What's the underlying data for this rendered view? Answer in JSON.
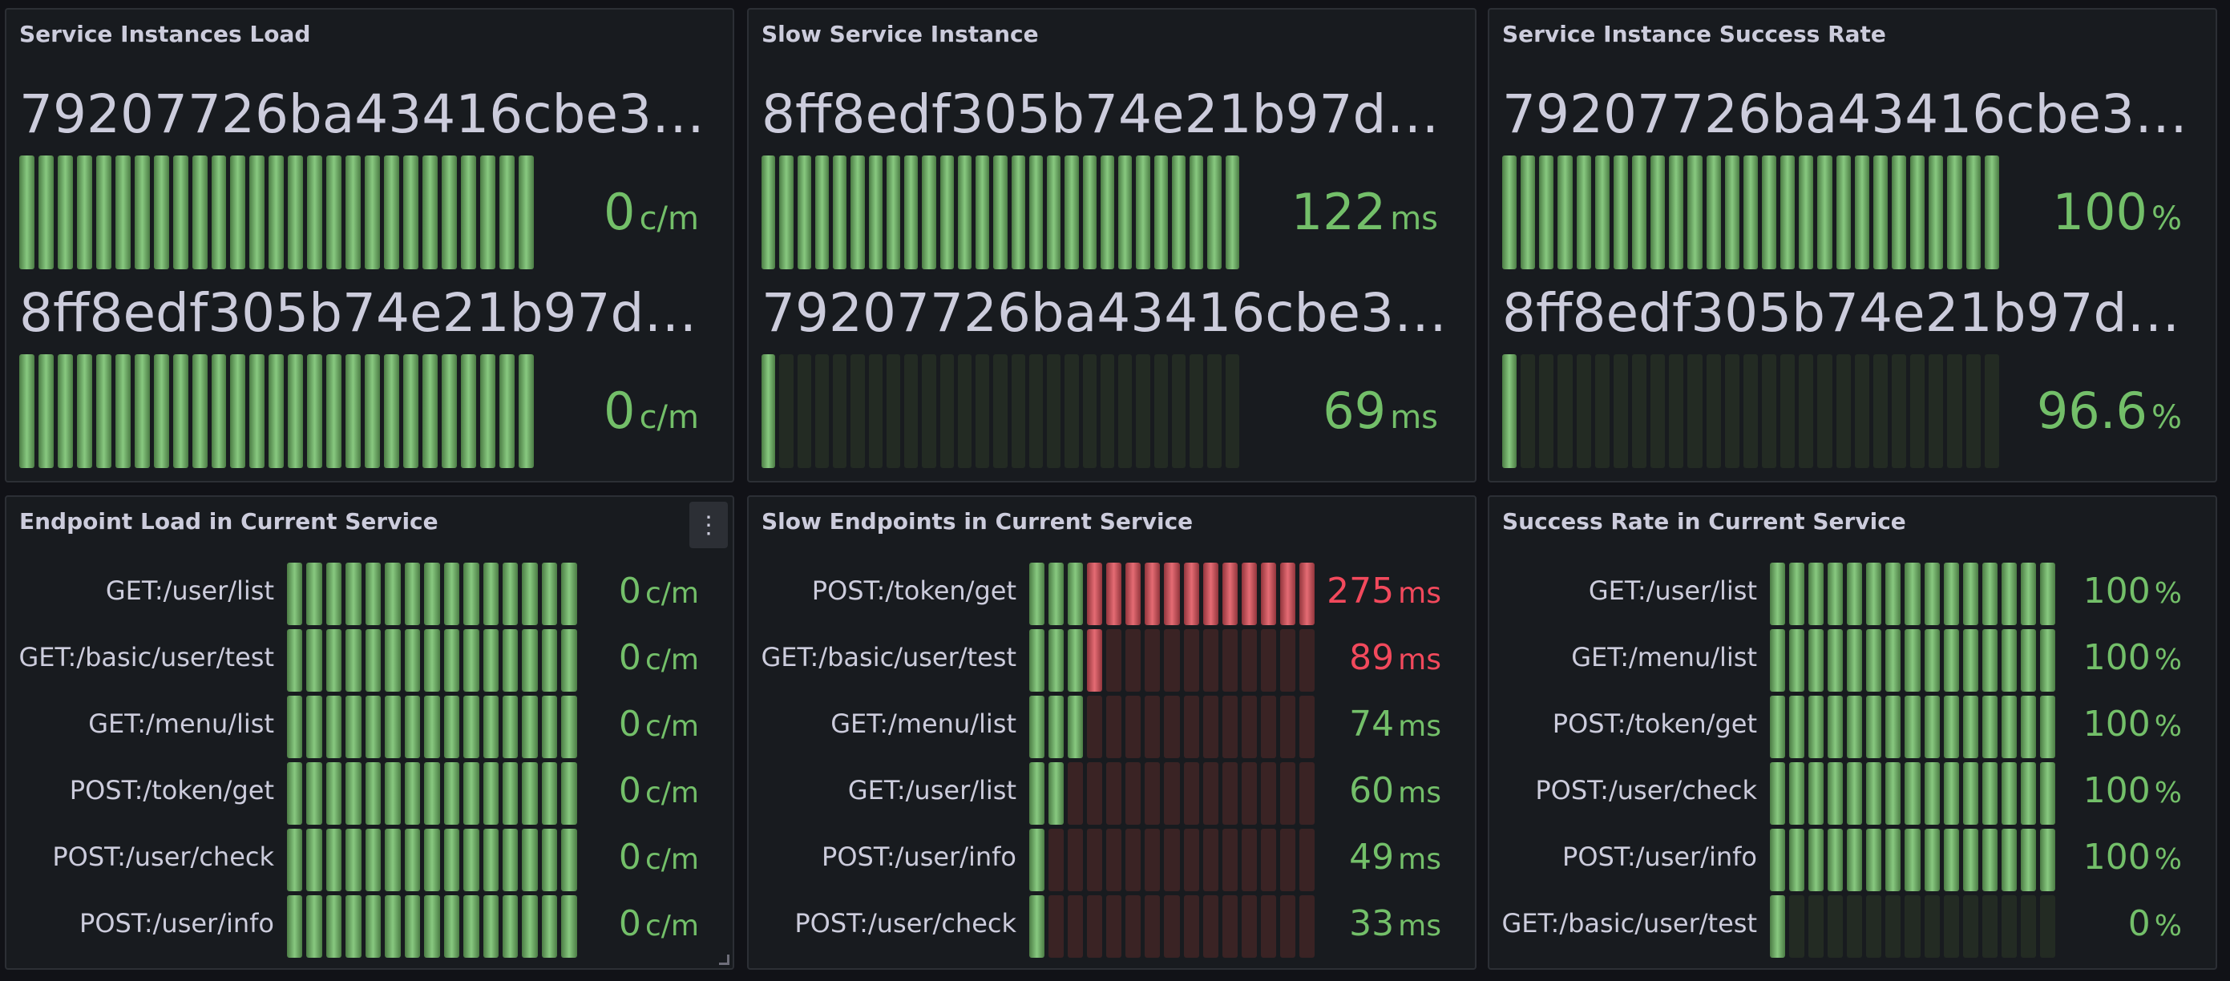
{
  "colors": {
    "green_lit": "#73bf69",
    "green_unlit": "#232b23",
    "red_lit": "#e0525c",
    "red_unlit": "#3a2324",
    "green_text": "#73bf69",
    "red_text": "#f2495c"
  },
  "panels": {
    "service_load": {
      "title": "Service Instances Load",
      "rows": [
        {
          "name": "79207726ba43416cbe3c...",
          "value": "0",
          "unit": "c/m",
          "fill": 1.0,
          "color": "green"
        },
        {
          "name": "8ff8edf305b74e21b97de...",
          "value": "0",
          "unit": "c/m",
          "fill": 1.0,
          "color": "green"
        }
      ]
    },
    "slow_instance": {
      "title": "Slow Service Instance",
      "rows": [
        {
          "name": "8ff8edf305b74e21b97de...",
          "value": "122",
          "unit": "ms",
          "fill": 1.0,
          "color": "green"
        },
        {
          "name": "79207726ba43416cbe3c...",
          "value": "69",
          "unit": "ms",
          "fill": 0.04,
          "color": "green"
        }
      ]
    },
    "success_rate": {
      "title": "Service Instance Success Rate",
      "rows": [
        {
          "name": "79207726ba43416cbe3c...",
          "value": "100",
          "unit": "%",
          "fill": 1.0,
          "color": "green"
        },
        {
          "name": "8ff8edf305b74e21b97de...",
          "value": "96.6",
          "unit": "%",
          "fill": 0.04,
          "color": "green"
        }
      ]
    },
    "endpoint_load": {
      "title": "Endpoint Load in Current Service",
      "menu_icon": "vertical-ellipsis-icon",
      "rows": [
        {
          "label": "GET:/user/list",
          "value": "0",
          "unit": "c/m",
          "green": 1.0,
          "red": 0
        },
        {
          "label": "GET:/basic/user/test",
          "value": "0",
          "unit": "c/m",
          "green": 1.0,
          "red": 0
        },
        {
          "label": "GET:/menu/list",
          "value": "0",
          "unit": "c/m",
          "green": 1.0,
          "red": 0
        },
        {
          "label": "POST:/token/get",
          "value": "0",
          "unit": "c/m",
          "green": 1.0,
          "red": 0
        },
        {
          "label": "POST:/user/check",
          "value": "0",
          "unit": "c/m",
          "green": 1.0,
          "red": 0
        },
        {
          "label": "POST:/user/info",
          "value": "0",
          "unit": "c/m",
          "green": 1.0,
          "red": 0
        }
      ]
    },
    "slow_endpoints": {
      "title": "Slow Endpoints in Current Service",
      "rows": [
        {
          "label": "POST:/token/get",
          "value": "275",
          "unit": "ms",
          "green": 0.2,
          "red": 0.8,
          "text_color": "red"
        },
        {
          "label": "GET:/basic/user/test",
          "value": "89",
          "unit": "ms",
          "green": 0.2,
          "red": 0.067,
          "text_color": "red"
        },
        {
          "label": "GET:/menu/list",
          "value": "74",
          "unit": "ms",
          "green": 0.2,
          "red": 0,
          "text_color": "green"
        },
        {
          "label": "GET:/user/list",
          "value": "60",
          "unit": "ms",
          "green": 0.133,
          "red": 0,
          "text_color": "green"
        },
        {
          "label": "POST:/user/info",
          "value": "49",
          "unit": "ms",
          "green": 0.067,
          "red": 0,
          "text_color": "green"
        },
        {
          "label": "POST:/user/check",
          "value": "33",
          "unit": "ms",
          "green": 0.067,
          "red": 0,
          "text_color": "green"
        }
      ]
    },
    "endpoint_success": {
      "title": "Success Rate in Current Service",
      "rows": [
        {
          "label": "GET:/user/list",
          "value": "100",
          "unit": "%",
          "green": 1.0,
          "red": 0
        },
        {
          "label": "GET:/menu/list",
          "value": "100",
          "unit": "%",
          "green": 1.0,
          "red": 0
        },
        {
          "label": "POST:/token/get",
          "value": "100",
          "unit": "%",
          "green": 1.0,
          "red": 0
        },
        {
          "label": "POST:/user/check",
          "value": "100",
          "unit": "%",
          "green": 1.0,
          "red": 0
        },
        {
          "label": "POST:/user/info",
          "value": "100",
          "unit": "%",
          "green": 1.0,
          "red": 0
        },
        {
          "label": "GET:/basic/user/test",
          "value": "0",
          "unit": "%",
          "green": 0.067,
          "red": 0
        }
      ]
    }
  }
}
